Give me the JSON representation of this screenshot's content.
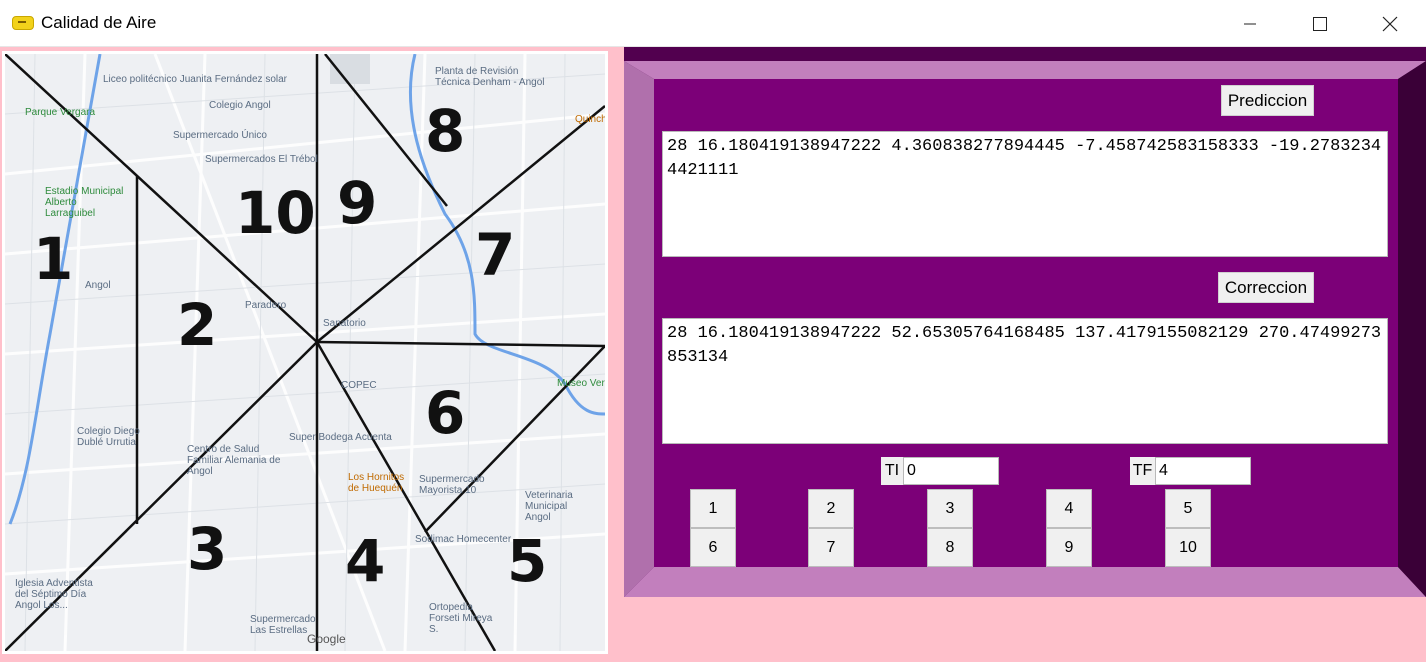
{
  "window": {
    "title": "Calidad de Aire",
    "icon": "app-icon",
    "controls": {
      "minimize_icon": "minimize-icon",
      "maximize_icon": "maximize-icon",
      "close_icon": "close-icon"
    }
  },
  "map": {
    "zones": [
      "1",
      "2",
      "3",
      "4",
      "5",
      "6",
      "7",
      "8",
      "9",
      "10"
    ],
    "places": [
      "Liceo politécnico Juanita Fernández solar",
      "Parque Vergara",
      "Colegio Angol",
      "Supermercado Único",
      "Supermercados El Trébol",
      "Estadio Municipal Alberto Larraguibel",
      "Angol",
      "Paradero",
      "Colegio Diego Dublé Urrutia",
      "Centro de Salud Familiar Alemania de Angol",
      "Super Bodega Acuenta",
      "Los Hornitos de Huequén",
      "Supermercado Mayorista 10",
      "Sodimac Homecenter",
      "Iglesia Adventista del Séptimo Día Angol Los...",
      "Supermercado Las Estrellas",
      "Google",
      "Planta de Revisión Técnica Denham - Angol",
      "Quincho",
      "Museo Verde",
      "Veterinaria Municipal Angol",
      "Ortopedia Forseti Mireya S.",
      "COPEC",
      "Sanatorio"
    ]
  },
  "panel": {
    "prediction_button": "Prediccion",
    "prediction_text": "28 16.180419138947222 4.360838277894445 -7.458742583158333 -19.27832344421111",
    "correction_button": "Correccion",
    "correction_text": "28 16.180419138947222 52.65305764168485 137.4179155082129 270.47499273853134",
    "ti_label": "TI",
    "ti_value": "0",
    "tf_label": "TF",
    "tf_value": "4",
    "zone_buttons": [
      "1",
      "2",
      "3",
      "4",
      "5",
      "6",
      "7",
      "8",
      "9",
      "10"
    ]
  },
  "colors": {
    "background": "#ffc0cb",
    "panel_dark": "#52004f",
    "panel_mid": "#7c0078",
    "bevel_light": "#c27fbd"
  }
}
